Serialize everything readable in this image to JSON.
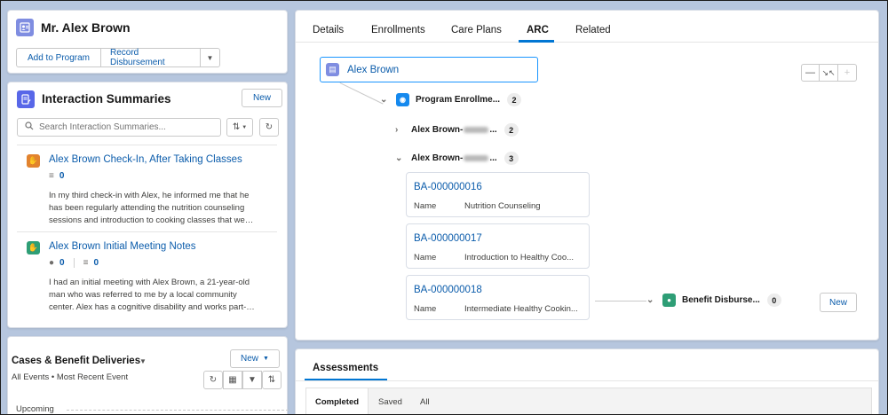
{
  "header": {
    "title": "Mr. Alex Brown",
    "actions": [
      "Add to Program",
      "Record Disbursement"
    ],
    "more_icon": "chevron-down-icon"
  },
  "interaction_summaries": {
    "title": "Interaction Summaries",
    "new_label": "New",
    "search_placeholder": "Search Interaction Summaries...",
    "items": [
      {
        "title": "Alex Brown Check-In, After Taking Classes",
        "icon": "handshake-icon",
        "icon_color": "#e2832e",
        "metrics": [
          {
            "icon": "list-icon",
            "value": "0"
          }
        ],
        "body": "In my third check-in with Alex, he informed me that he has been regularly attending the nutrition counseling sessions and introduction to cooking classes that we…"
      },
      {
        "title": "Alex Brown Initial Meeting Notes",
        "icon": "handshake-icon",
        "icon_color": "#2e9e76",
        "metrics": [
          {
            "icon": "person-icon",
            "value": "0"
          },
          {
            "icon": "list-icon",
            "value": "0"
          }
        ],
        "body": "I had an initial meeting with Alex Brown, a 21-year-old man who was referred to me by a local community center. Alex has a cognitive disability and works part-…"
      }
    ]
  },
  "cases": {
    "title": "Cases & Benefit Deliveries",
    "subtitle": "All Events • Most Recent Event",
    "new_label": "New",
    "upcoming_label": "Upcoming"
  },
  "tabs": [
    "Details",
    "Enrollments",
    "Care Plans",
    "ARC",
    "Related"
  ],
  "active_tab": "ARC",
  "arc": {
    "root": "Alex Brown",
    "program_enrollments": {
      "label": "Program Enrollme...",
      "count": "2"
    },
    "enrollment_a": {
      "prefix": "Alex Brown-",
      "suffix": "...",
      "count": "2"
    },
    "enrollment_b": {
      "prefix": "Alex Brown-",
      "suffix": "...",
      "count": "3"
    },
    "records": [
      {
        "id": "BA-000000016",
        "field": "Name",
        "value": "Nutrition Counseling"
      },
      {
        "id": "BA-000000017",
        "field": "Name",
        "value": "Introduction to Healthy Coo..."
      },
      {
        "id": "BA-000000018",
        "field": "Name",
        "value": "Intermediate Healthy Cookin..."
      }
    ],
    "benefit_disbursements": {
      "label": "Benefit Disburse...",
      "count": "0",
      "new_label": "New"
    }
  },
  "assessments": {
    "title": "Assessments",
    "subtabs": [
      "Completed",
      "Saved",
      "All"
    ]
  },
  "colors": {
    "accent": "#0176d3",
    "link": "#0b5cab",
    "contact_icon": "#7f8de1",
    "summary_icon": "#5867e8",
    "program_icon": "#1589ee",
    "disbursement_icon": "#2e9e76"
  }
}
